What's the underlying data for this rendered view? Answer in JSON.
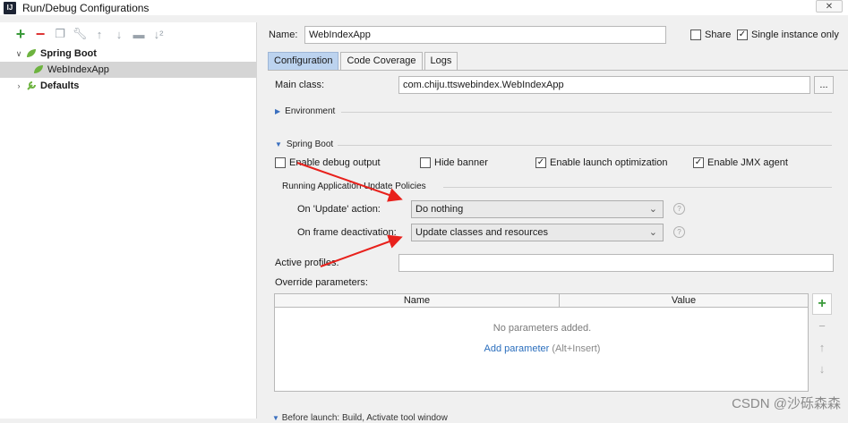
{
  "window": {
    "title": "Run/Debug Configurations",
    "app_icon": "intellij-icon",
    "close_label": "✕"
  },
  "left_panel": {
    "toolbar_icons": [
      "add-icon",
      "remove-icon",
      "copy-icon",
      "wrench-icon",
      "move-up-icon",
      "move-down-icon",
      "folder-icon",
      "sort-icon"
    ],
    "tree": [
      {
        "label": "Spring Boot",
        "expanded": true,
        "icon": "spring-leaf-icon"
      },
      {
        "label": "WebIndexApp",
        "selected": true,
        "icon": "spring-leaf-icon"
      },
      {
        "label": "Defaults",
        "expanded": false,
        "icon": "wrench-icon"
      }
    ]
  },
  "header": {
    "name_label": "Name:",
    "name_value": "WebIndexApp",
    "share_label": "Share",
    "share_checked": false,
    "single_instance_label": "Single instance only",
    "single_instance_checked": true
  },
  "tabs": [
    {
      "label": "Configuration",
      "active": true
    },
    {
      "label": "Code Coverage",
      "active": false
    },
    {
      "label": "Logs",
      "active": false
    }
  ],
  "configuration": {
    "main_class_label": "Main class:",
    "main_class_value": "com.chiju.ttswebindex.WebIndexApp",
    "browse_label": "...",
    "environment_label": "Environment",
    "spring_boot_label": "Spring Boot",
    "options": [
      {
        "label": "Enable debug output",
        "checked": false
      },
      {
        "label": "Hide banner",
        "checked": false
      },
      {
        "label": "Enable launch optimization",
        "checked": true
      },
      {
        "label": "Enable JMX agent",
        "checked": true
      }
    ],
    "update_policies_label": "Running Application Update Policies",
    "on_update_label": "On 'Update' action:",
    "on_update_value": "Do nothing",
    "on_frame_label": "On frame deactivation:",
    "on_frame_value": "Update classes and resources",
    "active_profiles_label": "Active profiles:",
    "active_profiles_value": "",
    "override_label": "Override parameters:",
    "table": {
      "columns": [
        "Name",
        "Value"
      ],
      "empty_text": "No parameters added.",
      "add_link": "Add parameter",
      "add_hint": "(Alt+Insert)"
    },
    "before_launch": "Before launch: Build, Activate tool window"
  },
  "watermark": "CSDN @沙砾森森",
  "annotation_color": "#e8211c"
}
